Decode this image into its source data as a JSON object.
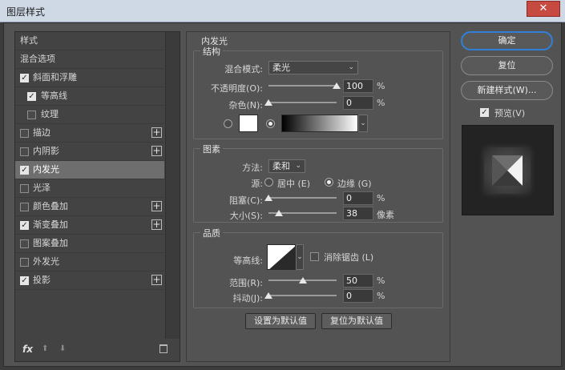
{
  "window": {
    "title": "图层样式",
    "close_icon": "close-icon"
  },
  "left": {
    "items": [
      {
        "label": "样式",
        "checkbox": false,
        "checked": false,
        "plus": false,
        "selected": false,
        "sub": false
      },
      {
        "label": "混合选项",
        "checkbox": false,
        "checked": false,
        "plus": false,
        "selected": false,
        "sub": false
      },
      {
        "label": "斜面和浮雕",
        "checkbox": true,
        "checked": true,
        "plus": false,
        "selected": false,
        "sub": false
      },
      {
        "label": "等高线",
        "checkbox": true,
        "checked": true,
        "plus": false,
        "selected": false,
        "sub": true
      },
      {
        "label": "纹理",
        "checkbox": true,
        "checked": false,
        "plus": false,
        "selected": false,
        "sub": true
      },
      {
        "label": "描边",
        "checkbox": true,
        "checked": false,
        "plus": true,
        "selected": false,
        "sub": false
      },
      {
        "label": "内阴影",
        "checkbox": true,
        "checked": false,
        "plus": true,
        "selected": false,
        "sub": false
      },
      {
        "label": "内发光",
        "checkbox": true,
        "checked": true,
        "plus": false,
        "selected": true,
        "sub": false
      },
      {
        "label": "光泽",
        "checkbox": true,
        "checked": false,
        "plus": false,
        "selected": false,
        "sub": false
      },
      {
        "label": "颜色叠加",
        "checkbox": true,
        "checked": false,
        "plus": true,
        "selected": false,
        "sub": false
      },
      {
        "label": "渐变叠加",
        "checkbox": true,
        "checked": true,
        "plus": true,
        "selected": false,
        "sub": false
      },
      {
        "label": "图案叠加",
        "checkbox": true,
        "checked": false,
        "plus": false,
        "selected": false,
        "sub": false
      },
      {
        "label": "外发光",
        "checkbox": true,
        "checked": false,
        "plus": false,
        "selected": false,
        "sub": false
      },
      {
        "label": "投影",
        "checkbox": true,
        "checked": true,
        "plus": true,
        "selected": false,
        "sub": false
      }
    ],
    "footer": {
      "fx": "fx"
    }
  },
  "main": {
    "section_title": "内发光",
    "structure": {
      "title": "结构",
      "blend_mode_label": "混合模式:",
      "blend_mode_value": "柔光",
      "opacity_label": "不透明度(O):",
      "opacity_value": "100",
      "opacity_fraction": 1.0,
      "noise_label": "杂色(N):",
      "noise_value": "0",
      "noise_fraction": 0.0,
      "percent": "%"
    },
    "elements": {
      "title": "图素",
      "method_label": "方法:",
      "method_value": "柔和",
      "source_label": "源:",
      "source_center": "居中 (E)",
      "source_edge": "边缘 (G)",
      "choke_label": "阻塞(C):",
      "choke_value": "0",
      "choke_fraction": 0.0,
      "size_label": "大小(S):",
      "size_value": "38",
      "size_fraction": 0.15,
      "size_unit": "像素",
      "percent": "%"
    },
    "quality": {
      "title": "品质",
      "contour_label": "等高线:",
      "antialias_label": "消除锯齿 (L)",
      "range_label": "范围(R):",
      "range_value": "50",
      "range_fraction": 0.5,
      "jitter_label": "抖动(J):",
      "jitter_value": "0",
      "jitter_fraction": 0.0,
      "percent": "%"
    },
    "buttons": {
      "make_default": "设置为默认值",
      "reset_default": "复位为默认值"
    }
  },
  "right": {
    "ok": "确定",
    "reset": "复位",
    "new_style": "新建样式(W)...",
    "preview_label": "预览(V)",
    "preview_checked": true
  }
}
